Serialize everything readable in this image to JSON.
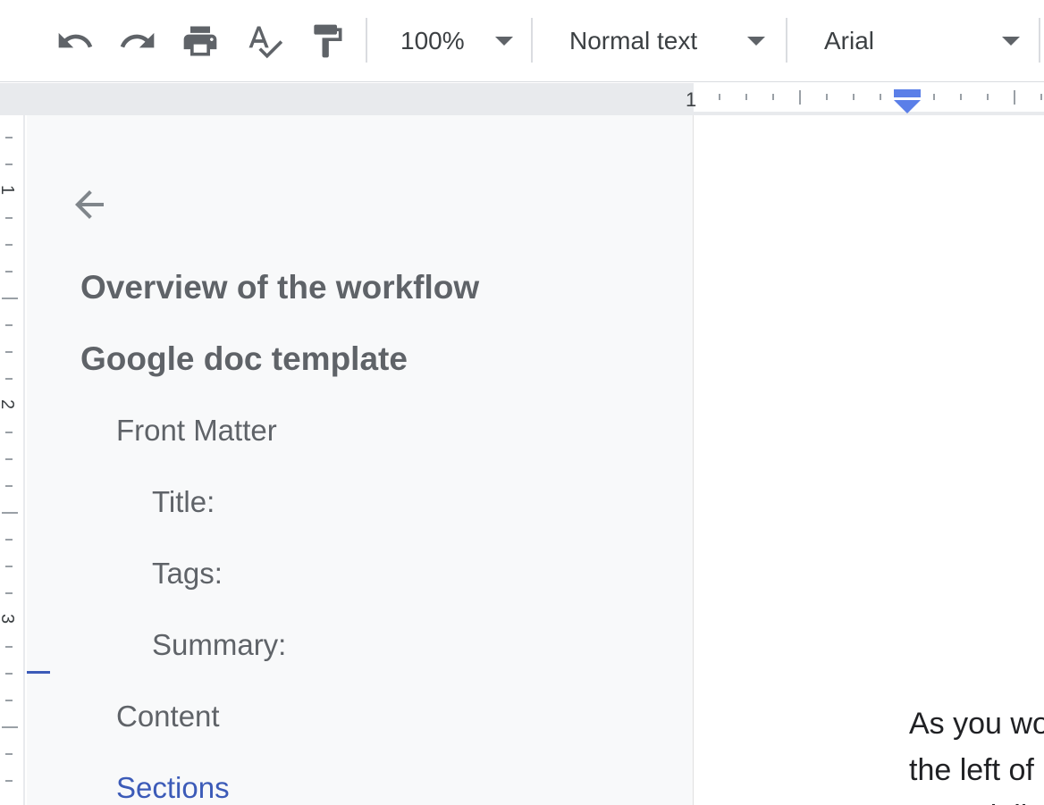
{
  "toolbar": {
    "zoom": "100%",
    "style": "Normal text",
    "font": "Arial",
    "icons": [
      "undo-icon",
      "redo-icon",
      "print-icon",
      "spellcheck-icon",
      "paint-format-icon"
    ]
  },
  "ruler": {
    "h_number": "1",
    "v_numbers": [
      "1",
      "2",
      "3"
    ]
  },
  "outline": {
    "items": [
      {
        "label": "Overview of the workflow",
        "level": 1
      },
      {
        "label": "Google doc template",
        "level": 1
      },
      {
        "label": "Front Matter",
        "level": 2
      },
      {
        "label": "Title:",
        "level": 3
      },
      {
        "label": "Tags:",
        "level": 3
      },
      {
        "label": "Summary:",
        "level": 3
      },
      {
        "label": "Content",
        "level": 2
      },
      {
        "label": "Sections",
        "level": 2,
        "active": true
      }
    ]
  },
  "document": {
    "lines": [
      "As you wo",
      "the left of",
      "especially"
    ]
  },
  "colors": {
    "active": "#3c5bb8",
    "ruler_marker": "#5b7fe8",
    "outline_bg": "#f8f9fa"
  }
}
